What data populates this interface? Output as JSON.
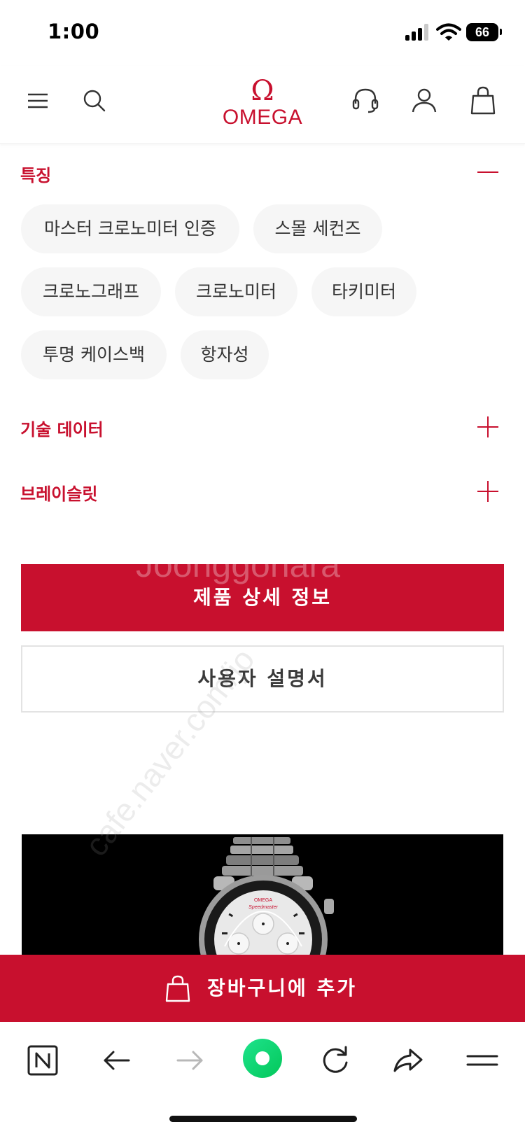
{
  "status_bar": {
    "time": "1:00",
    "battery": "66"
  },
  "header": {
    "logo_symbol": "Ω",
    "logo_text": "OMEGA",
    "brand_color": "#c8102e",
    "icons": [
      "menu-icon",
      "search-icon",
      "headset-icon",
      "user-icon",
      "bag-icon"
    ]
  },
  "accordion": {
    "features": {
      "title": "특징",
      "expanded": true,
      "chips": [
        "마스터 크로노미터 인증",
        "스몰 세컨즈",
        "크로노그래프",
        "크로노미터",
        "타키미터",
        "투명 케이스백",
        "항자성"
      ]
    },
    "technical_data": {
      "title": "기술 데이터",
      "expanded": false
    },
    "bracelet": {
      "title": "브레이슬릿",
      "expanded": false
    }
  },
  "buttons": {
    "product_details": "제품 상세 정보",
    "user_manual": "사용자 설명서"
  },
  "product_image": {
    "dial_brand": "OMEGA",
    "dial_model": "Speedmaster"
  },
  "cart": {
    "label": "장바구니에 추가"
  },
  "watermark": {
    "top": "Joonggonara",
    "diagonal": "cafe.naver.com/jo"
  },
  "browser_bar": {
    "icons": [
      "naver-icon",
      "back-arrow-icon",
      "forward-arrow-icon",
      "green-dot-icon",
      "reload-icon",
      "share-icon",
      "hamburger-icon"
    ]
  }
}
